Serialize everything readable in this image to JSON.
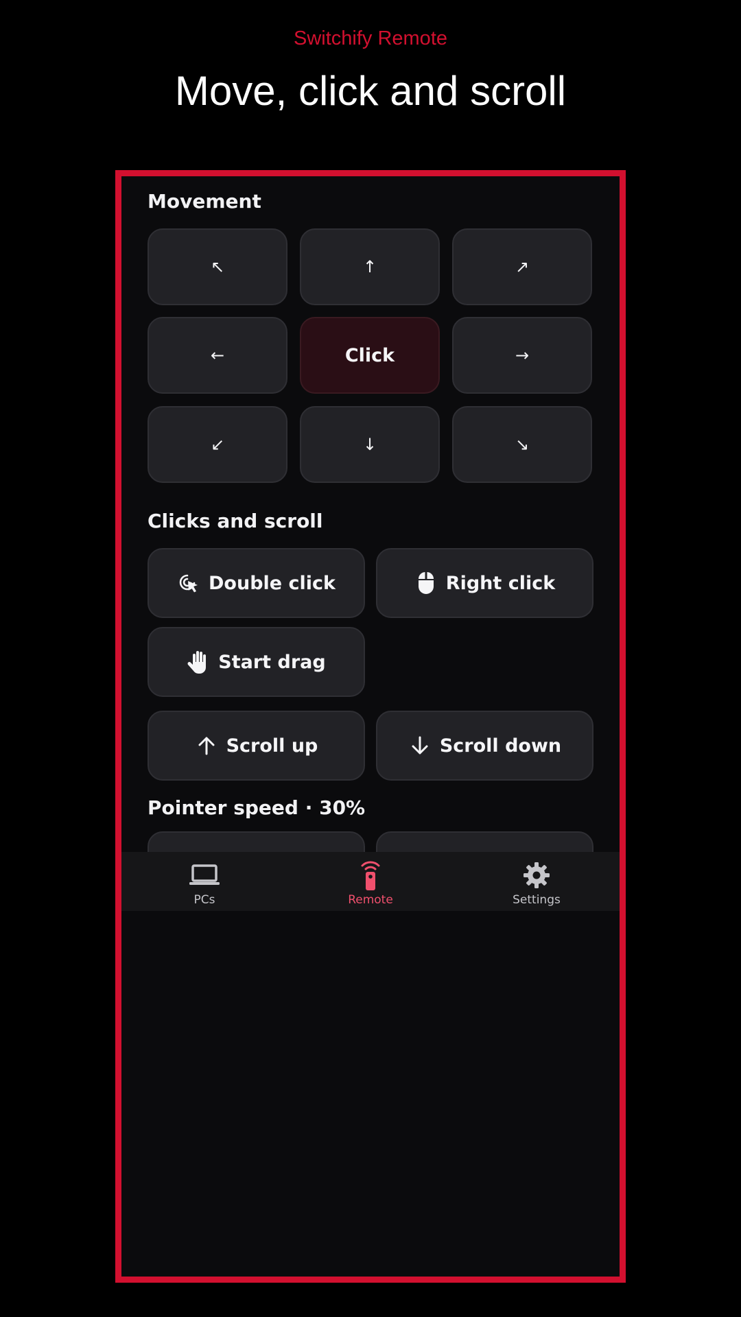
{
  "promo": {
    "eyebrow": "Switchify Remote",
    "title": "Move, click and scroll"
  },
  "colors": {
    "accent": "#d2102f",
    "active_nav": "#f0506d",
    "tile_bg": "#222226",
    "click_tile_bg": "#2a0e15"
  },
  "movement": {
    "title": "Movement",
    "up_left": "↖",
    "up": "↑",
    "up_right": "↗",
    "left": "←",
    "click": "Click",
    "right": "→",
    "down_left": "↙",
    "down": "↓",
    "down_right": "↘"
  },
  "clicks": {
    "title": "Clicks and scroll",
    "double_click": "Double click",
    "right_click": "Right click",
    "start_drag": "Start drag",
    "scroll_up": "Scroll up",
    "scroll_down": "Scroll down"
  },
  "pointer_speed": {
    "title": "Pointer speed · 30%"
  },
  "nav": {
    "items": [
      {
        "label": "PCs",
        "icon": "laptop-icon"
      },
      {
        "label": "Remote",
        "icon": "remote-icon",
        "active": true
      },
      {
        "label": "Settings",
        "icon": "gear-icon"
      }
    ]
  }
}
